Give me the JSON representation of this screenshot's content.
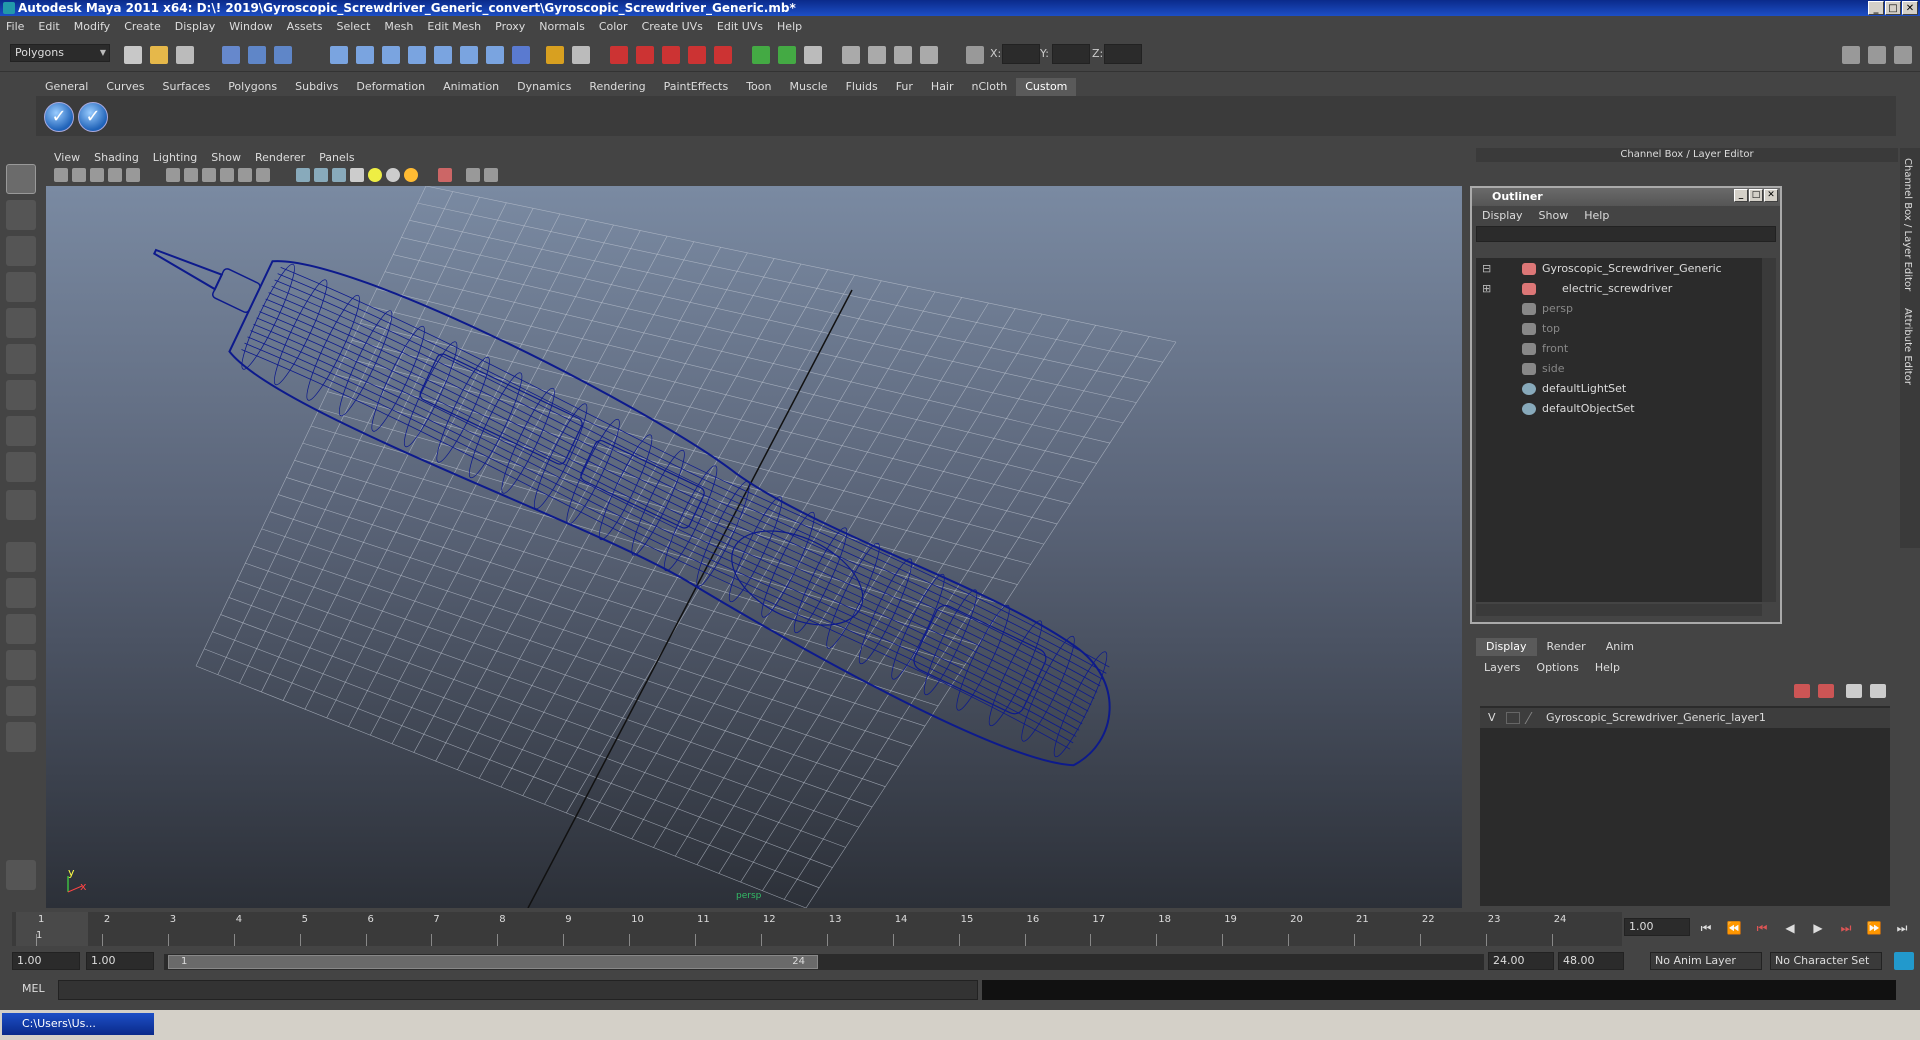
{
  "window": {
    "title": "Autodesk Maya 2011 x64: D:\\! 2019\\Gyroscopic_Screwdriver_Generic_convert\\Gyroscopic_Screwdriver_Generic.mb*",
    "min": "_",
    "max": "□",
    "close": "✕"
  },
  "menubar": [
    "File",
    "Edit",
    "Modify",
    "Create",
    "Display",
    "Window",
    "Assets",
    "Select",
    "Mesh",
    "Edit Mesh",
    "Proxy",
    "Normals",
    "Color",
    "Create UVs",
    "Edit UVs",
    "Help"
  ],
  "status_line": {
    "mode": "Polygons",
    "x_label": "X:",
    "y_label": "Y:",
    "z_label": "Z:"
  },
  "shelf_tabs": [
    "General",
    "Curves",
    "Surfaces",
    "Polygons",
    "Subdivs",
    "Deformation",
    "Animation",
    "Dynamics",
    "Rendering",
    "PaintEffects",
    "Toon",
    "Muscle",
    "Fluids",
    "Fur",
    "Hair",
    "nCloth",
    "Custom"
  ],
  "shelf_active": "Custom",
  "viewport": {
    "menu": [
      "View",
      "Shading",
      "Lighting",
      "Show",
      "Renderer",
      "Panels"
    ],
    "camera_label": "persp",
    "axis_x": "x",
    "axis_y": "y",
    "wire_color": "#0d1a8c"
  },
  "channel_box": {
    "title": "Channel Box / Layer Editor"
  },
  "outliner": {
    "title": "Outliner",
    "menu": [
      "Display",
      "Show",
      "Help"
    ],
    "items": [
      {
        "label": "Gyroscopic_Screwdriver_Generic",
        "dim": false
      },
      {
        "label": "electric_screwdriver",
        "dim": false
      },
      {
        "label": "persp",
        "dim": true
      },
      {
        "label": "top",
        "dim": true
      },
      {
        "label": "front",
        "dim": true
      },
      {
        "label": "side",
        "dim": true
      },
      {
        "label": "defaultLightSet",
        "dim": false
      },
      {
        "label": "defaultObjectSet",
        "dim": false
      }
    ]
  },
  "layer_editor": {
    "tabs": [
      "Display",
      "Render",
      "Anim"
    ],
    "menu": [
      "Layers",
      "Options",
      "Help"
    ],
    "layer": {
      "visibility": "V",
      "name": "Gyroscopic_Screwdriver_Generic_layer1"
    }
  },
  "side_tabs": [
    "Channel Box / Layer Editor",
    "Attribute Editor"
  ],
  "time_slider": {
    "ticks": [
      "1",
      "2",
      "3",
      "4",
      "5",
      "6",
      "7",
      "8",
      "9",
      "10",
      "11",
      "12",
      "13",
      "14",
      "15",
      "16",
      "17",
      "18",
      "19",
      "20",
      "21",
      "22",
      "23",
      "24"
    ],
    "current_frame": "1.00",
    "start_marker": "1"
  },
  "range": {
    "start": "1.00",
    "playback_start": "1.00",
    "slider_start": "1",
    "slider_end": "24",
    "playback_end": "24.00",
    "end": "48.00",
    "anim_layer": "No Anim Layer",
    "character_set": "No Character Set"
  },
  "command_line": {
    "label": "MEL"
  },
  "taskbar": {
    "item": "C:\\Users\\Us..."
  }
}
